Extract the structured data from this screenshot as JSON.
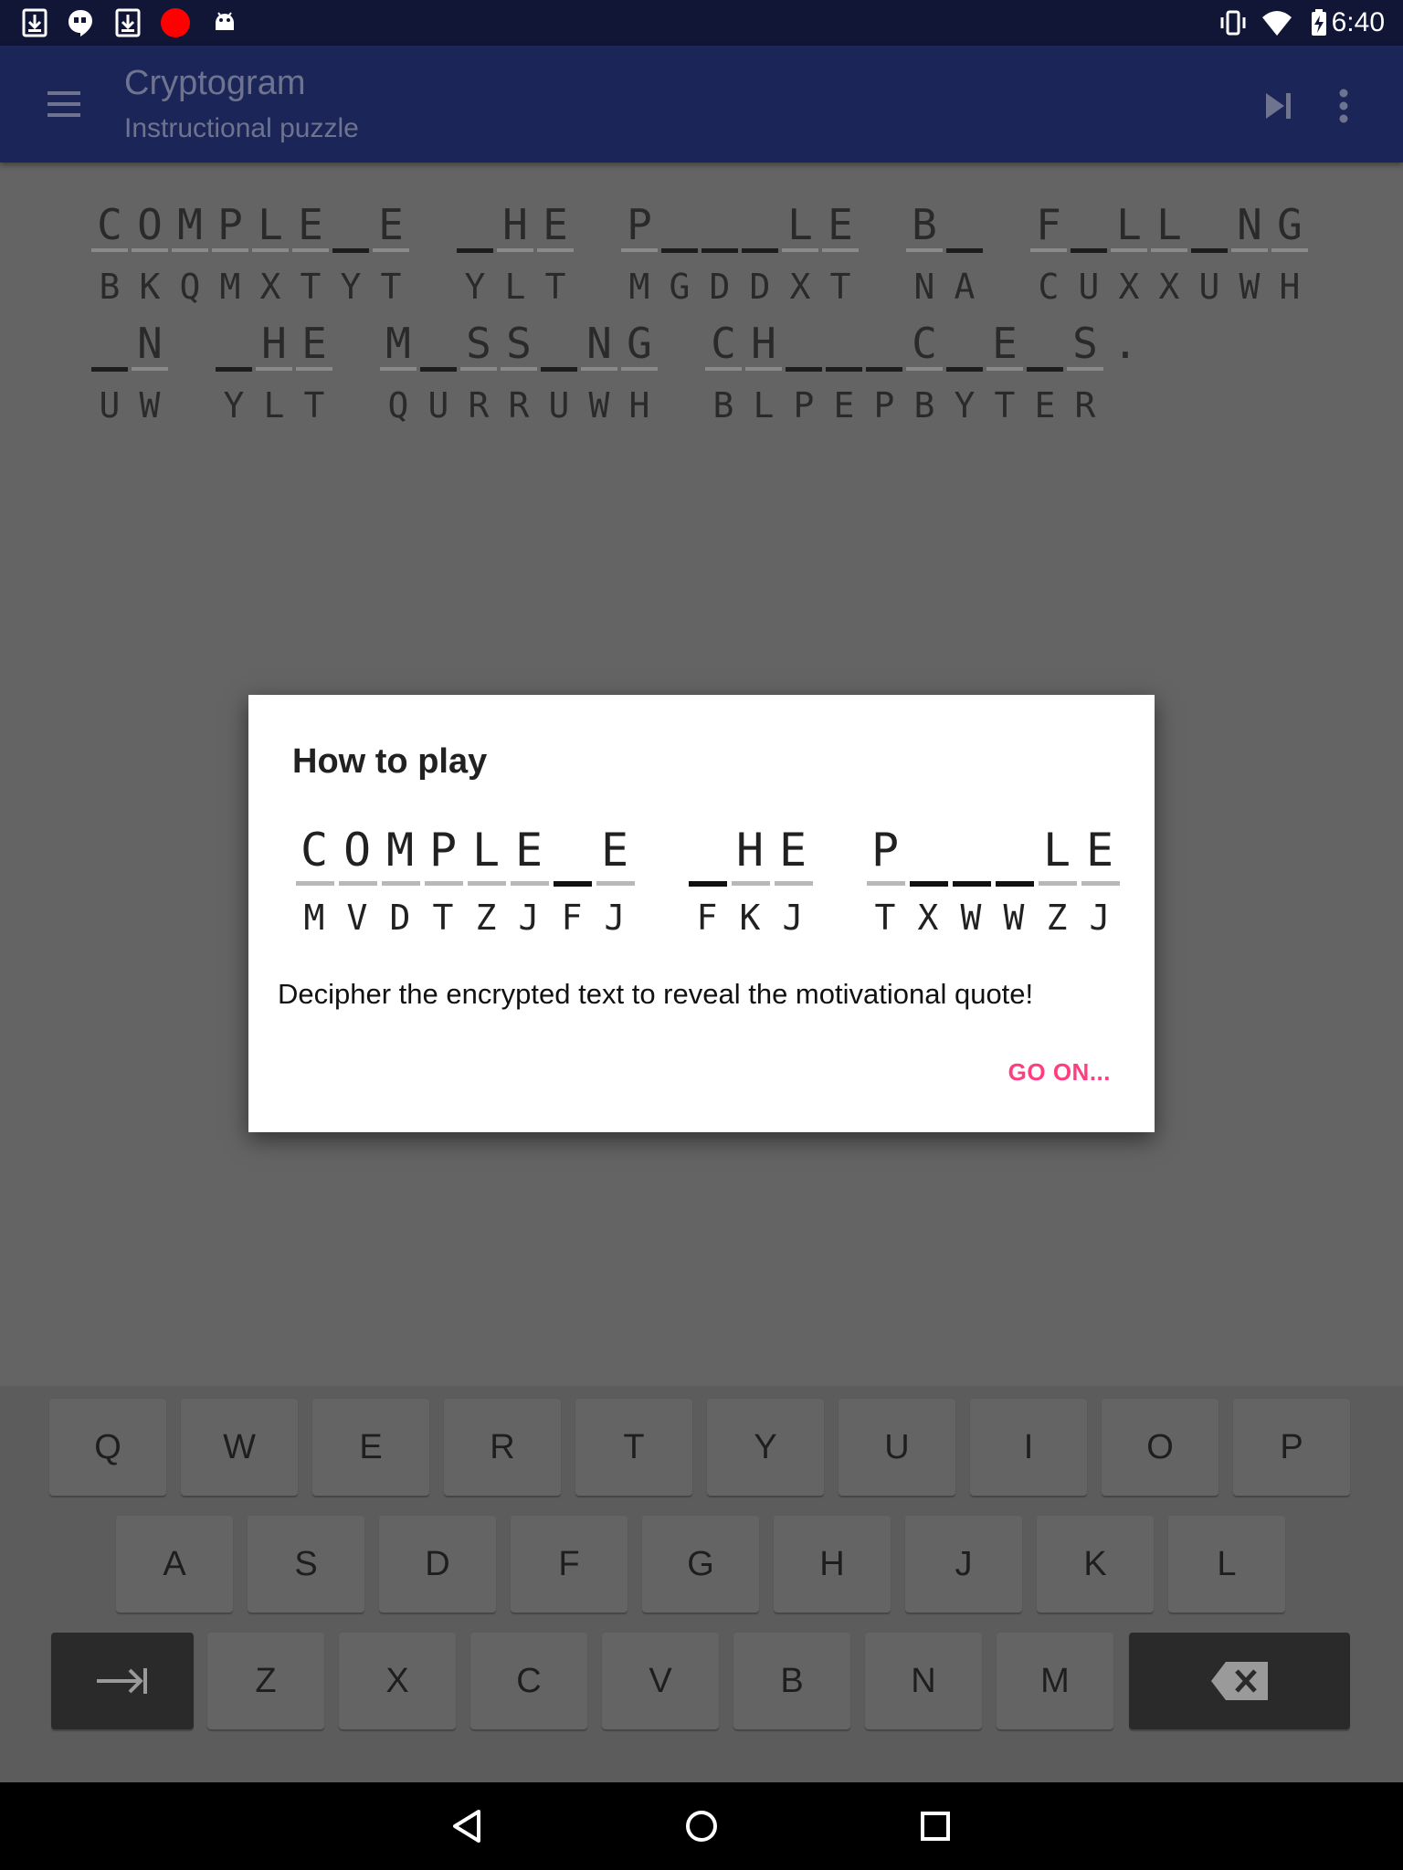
{
  "status_bar": {
    "time": "6:40",
    "left_icons": [
      "download-icon",
      "hangouts-icon",
      "download-icon",
      "record-icon",
      "android-debug-icon"
    ],
    "right_icons": [
      "vibrate-icon",
      "wifi-icon",
      "battery-charging-icon"
    ]
  },
  "app_bar": {
    "title": "Cryptogram",
    "subtitle": "Instructional puzzle",
    "actions": [
      "menu-icon",
      "skip-next-icon",
      "more-vert-icon"
    ]
  },
  "puzzle": {
    "lines": [
      {
        "words": [
          {
            "plain": [
              "C",
              "O",
              "M",
              "P",
              "L",
              "E",
              "",
              "E"
            ],
            "cipher": [
              "B",
              "K",
              "Q",
              "M",
              "X",
              "T",
              "Y",
              "T"
            ]
          },
          {
            "plain": [
              "",
              "H",
              "E"
            ],
            "cipher": [
              "Y",
              "L",
              "T"
            ]
          },
          {
            "plain": [
              "P",
              "",
              "",
              "",
              "L",
              "E"
            ],
            "cipher": [
              "M",
              "G",
              "D",
              "D",
              "X",
              "T"
            ]
          },
          {
            "plain": [
              "B",
              ""
            ],
            "cipher": [
              "N",
              "A"
            ]
          },
          {
            "plain": [
              "F",
              "",
              "L",
              "L",
              "",
              "N",
              "G"
            ],
            "cipher": [
              "C",
              "U",
              "X",
              "X",
              "U",
              "W",
              "H"
            ]
          }
        ]
      },
      {
        "words": [
          {
            "plain": [
              "",
              "N"
            ],
            "cipher": [
              "U",
              "W"
            ]
          },
          {
            "plain": [
              "",
              "H",
              "E"
            ],
            "cipher": [
              "Y",
              "L",
              "T"
            ]
          },
          {
            "plain": [
              "M",
              "",
              "S",
              "S",
              "",
              "N",
              "G"
            ],
            "cipher": [
              "Q",
              "U",
              "R",
              "R",
              "U",
              "W",
              "H"
            ]
          },
          {
            "plain": [
              "C",
              "H",
              "",
              "",
              "",
              "C",
              "",
              "E",
              "",
              "S"
            ],
            "cipher": [
              "B",
              "L",
              "P",
              "E",
              "P",
              "B",
              "Y",
              "T",
              "E",
              "R"
            ],
            "trailing": "."
          }
        ]
      }
    ]
  },
  "dialog": {
    "title": "How to play",
    "example": {
      "words": [
        {
          "plain": [
            "C",
            "O",
            "M",
            "P",
            "L",
            "E",
            "",
            "E"
          ],
          "cipher": [
            "M",
            "V",
            "D",
            "T",
            "Z",
            "J",
            "F",
            "J"
          ]
        },
        {
          "plain": [
            "",
            "H",
            "E"
          ],
          "cipher": [
            "F",
            "K",
            "J"
          ]
        },
        {
          "plain": [
            "P",
            "",
            "",
            "",
            "L",
            "E"
          ],
          "cipher": [
            "T",
            "X",
            "W",
            "W",
            "Z",
            "J"
          ]
        }
      ]
    },
    "message": "Decipher the encrypted text to reveal the motivational quote!",
    "button": "GO ON..."
  },
  "keyboard": {
    "row1": [
      "Q",
      "W",
      "E",
      "R",
      "T",
      "Y",
      "U",
      "I",
      "O",
      "P"
    ],
    "row2": [
      "A",
      "S",
      "D",
      "F",
      "G",
      "H",
      "J",
      "K",
      "L"
    ],
    "row3": [
      "Z",
      "X",
      "C",
      "V",
      "B",
      "N",
      "M"
    ],
    "tab_key_icon": "tab-icon",
    "backspace_key_icon": "backspace-icon"
  },
  "nav_bar": {
    "buttons": [
      "back-icon",
      "home-icon",
      "recents-icon"
    ]
  },
  "colors": {
    "status_bar": "#111536",
    "app_bar": "#1c2557",
    "overlay_bg": "#646464",
    "accent": "#ff3d7f",
    "dialog_bg": "#ffffff"
  }
}
